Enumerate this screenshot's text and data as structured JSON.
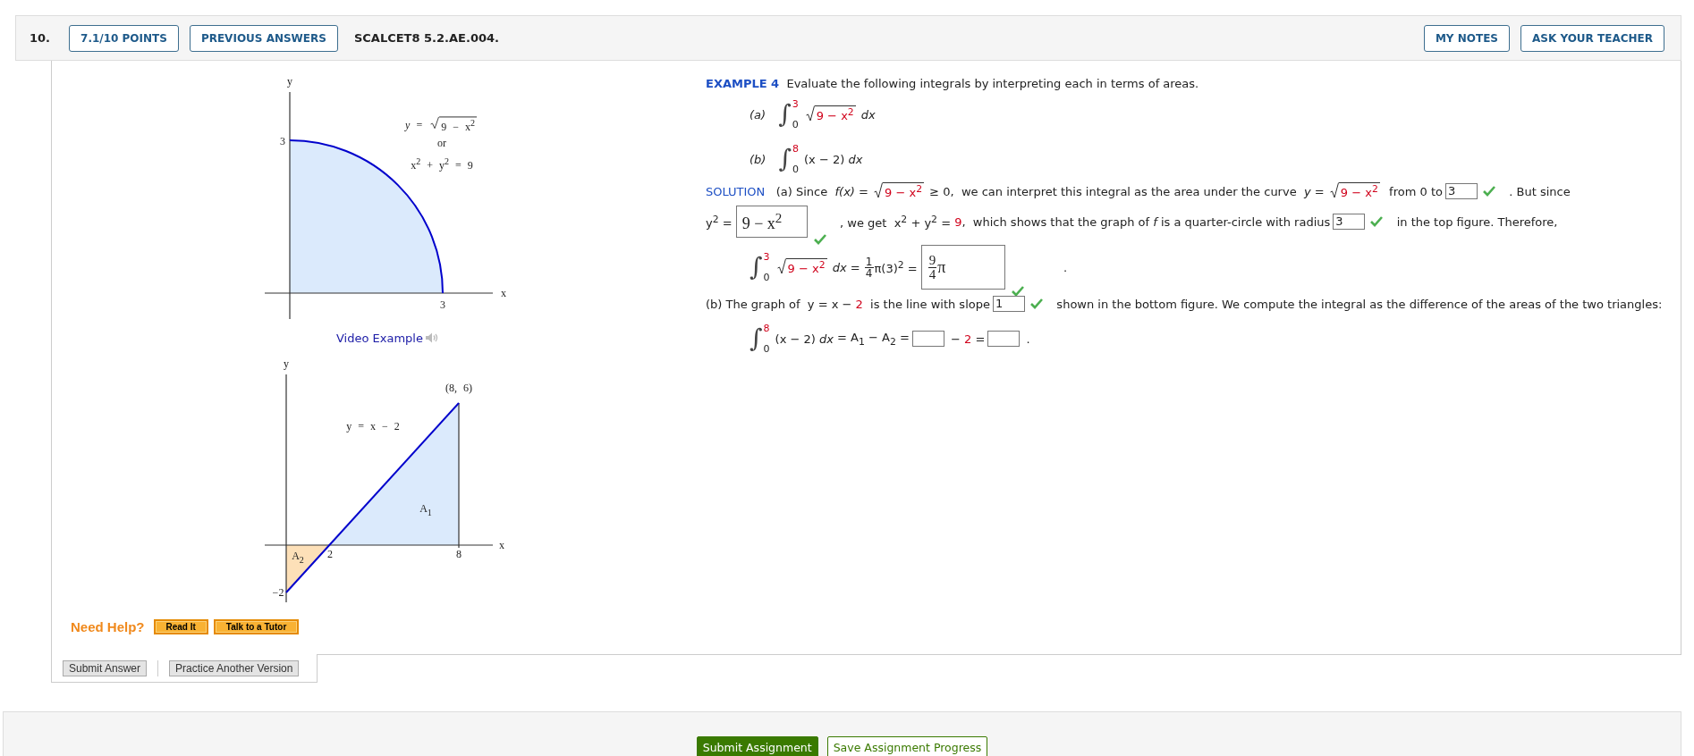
{
  "header": {
    "number": "10.",
    "buttons": [
      {
        "label": "7.1/10 POINTS"
      },
      {
        "label": "PREVIOUS ANSWERS"
      }
    ],
    "code": "SCALCET8 5.2.AE.004.",
    "right_buttons": [
      {
        "label": "MY NOTES"
      },
      {
        "label": "ASK YOUR TEACHER"
      }
    ]
  },
  "figures": [
    {
      "kind": "quarter-circle",
      "labels": [
        {
          "kind": "y-axis",
          "text": "y"
        },
        {
          "kind": "y-tick",
          "text": "3"
        },
        {
          "kind": "equation",
          "tokens": [
            {
              "kind": "em",
              "text": "y"
            },
            {
              "kind": "text",
              "text": " = "
            },
            {
              "kind": "sqrt",
              "body": [
                {
                  "kind": "text",
                  "text": "9 − x$^{2}$"
                }
              ]
            }
          ]
        },
        {
          "kind": "or",
          "text": "or"
        },
        {
          "kind": "circle-equation",
          "text": "x$^{2}$ + y$^{2}$ = 9"
        },
        {
          "kind": "x-axis",
          "text": "x"
        },
        {
          "kind": "x-tick",
          "text": "3"
        }
      ]
    },
    {
      "kind": "triangles",
      "labels": [
        {
          "kind": "y-axis",
          "text": "y"
        },
        {
          "kind": "point",
          "text": "(8, 6)"
        },
        {
          "kind": "line-equation",
          "text": "y = x − 2"
        },
        {
          "kind": "area-upper",
          "text": "A$_{1}$"
        },
        {
          "kind": "area-lower",
          "text": "A$_{2}$"
        },
        {
          "kind": "x-tick-zero",
          "text": "2"
        },
        {
          "kind": "x-tick-end",
          "text": "8"
        },
        {
          "kind": "x-axis",
          "text": "x"
        },
        {
          "kind": "y-tick",
          "text": "−2"
        }
      ]
    }
  ],
  "video_link": {
    "label": "Video Example"
  },
  "help": {
    "label": "Need Help?",
    "buttons": [
      {
        "label": "Read It"
      },
      {
        "label": "Talk to a Tutor"
      }
    ]
  },
  "question_buttons": [
    {
      "label": "Submit Answer"
    },
    {
      "label": "Practice Another Version"
    }
  ],
  "example": {
    "lines": [
      {
        "kind": "heading",
        "tokens": [
          {
            "kind": "label",
            "text": "EXAMPLE 4"
          },
          {
            "kind": "text",
            "text": "  Evaluate the following integrals by interpreting each in terms of areas."
          }
        ]
      },
      {
        "kind": "part",
        "tokens": [
          {
            "kind": "em",
            "text": "(a)"
          },
          {
            "kind": "int",
            "sign": "∫",
            "upper": "3",
            "upper_red": true,
            "lower": "0"
          },
          {
            "kind": "sqrt",
            "body": [
              {
                "kind": "red",
                "text": "9 − x$^{2}$"
              }
            ]
          },
          {
            "kind": "em",
            "text": " dx"
          }
        ]
      },
      {
        "kind": "part",
        "tokens": [
          {
            "kind": "em",
            "text": "(b)"
          },
          {
            "kind": "int",
            "sign": "∫",
            "upper": "8",
            "upper_red": true,
            "lower": "0"
          },
          {
            "kind": "text",
            "text": "(x − 2) "
          },
          {
            "kind": "em",
            "text": "dx"
          }
        ]
      },
      {
        "kind": "plain",
        "tokens": [
          {
            "kind": "label",
            "text": "SOLUTION"
          },
          {
            "kind": "text",
            "text": "   (a) Since  "
          },
          {
            "kind": "em",
            "text": "f(x)"
          },
          {
            "kind": "text",
            "text": " = "
          },
          {
            "kind": "sqrt",
            "body": [
              {
                "kind": "red",
                "text": "9 − x$^{2}$"
              }
            ]
          },
          {
            "kind": "text",
            "text": " ≥ 0,  we can interpret this integral as the area under the curve  "
          },
          {
            "kind": "em",
            "text": "y"
          },
          {
            "kind": "text",
            "text": " = "
          },
          {
            "kind": "sqrt",
            "body": [
              {
                "kind": "red",
                "text": "9 − x$^{2}$"
              }
            ]
          },
          {
            "kind": "text",
            "text": "  from 0 to"
          },
          {
            "kind": "input",
            "value": "3",
            "correct": true
          },
          {
            "kind": "text",
            "text": "   . But since"
          }
        ]
      },
      {
        "kind": "plain",
        "tokens": [
          {
            "kind": "text",
            "text": "y$^{2}$ ="
          },
          {
            "kind": "box",
            "correct": true,
            "body": [
              {
                "kind": "serif",
                "text": "9 − x$^{2}$"
              }
            ]
          },
          {
            "kind": "text",
            "text": "   , we get  x$^{2}$ + y$^{2}$ = "
          },
          {
            "kind": "red",
            "text": "9"
          },
          {
            "kind": "text",
            "text": ",  which shows that the graph of "
          },
          {
            "kind": "em",
            "text": "f"
          },
          {
            "kind": "text",
            "text": " is a quarter-circle with radius"
          },
          {
            "kind": "input",
            "value": "3",
            "correct": true
          },
          {
            "kind": "text",
            "text": "   in the top figure. Therefore,"
          }
        ]
      },
      {
        "kind": "display",
        "tokens": [
          {
            "kind": "int",
            "sign": "∫",
            "upper": "3",
            "upper_red": true,
            "lower": "0"
          },
          {
            "kind": "sqrt",
            "body": [
              {
                "kind": "red",
                "text": "9 − x$^{2}$"
              }
            ]
          },
          {
            "kind": "em",
            "text": " dx"
          },
          {
            "kind": "text",
            "text": " = "
          },
          {
            "kind": "frac",
            "num": "1",
            "den": "4"
          },
          {
            "kind": "text",
            "text": "π(3)$^{2}$ ="
          },
          {
            "kind": "box",
            "correct": true,
            "body": [
              {
                "kind": "frac",
                "num": "9",
                "den": "4"
              },
              {
                "kind": "serif",
                "text": "π"
              }
            ]
          },
          {
            "kind": "text",
            "text": "          ."
          }
        ]
      },
      {
        "kind": "plain",
        "tokens": [
          {
            "kind": "text",
            "text": "(b) The graph of  y = x − "
          },
          {
            "kind": "red",
            "text": "2"
          },
          {
            "kind": "text",
            "text": "  is the line with slope"
          },
          {
            "kind": "input",
            "value": "1",
            "correct": true
          },
          {
            "kind": "text",
            "text": "   shown in the bottom figure. We compute the integral as the difference of the areas of the two triangles:"
          }
        ]
      },
      {
        "kind": "display",
        "tokens": [
          {
            "kind": "int",
            "sign": "∫",
            "upper": "8",
            "upper_red": true,
            "lower": "0"
          },
          {
            "kind": "text",
            "text": "(x − 2) "
          },
          {
            "kind": "em",
            "text": "dx"
          },
          {
            "kind": "text",
            "text": " = A$_{1}$ − A$_{2}$ ="
          },
          {
            "kind": "input",
            "correct": false
          },
          {
            "kind": "text",
            "text": " − "
          },
          {
            "kind": "red",
            "text": "2"
          },
          {
            "kind": "text",
            "text": " ="
          },
          {
            "kind": "input",
            "correct": false
          },
          {
            "kind": "text",
            "text": " ."
          }
        ]
      }
    ]
  },
  "footer_buttons": [
    {
      "label": "Submit Assignment",
      "primary": true
    },
    {
      "label": "Save Assignment Progress",
      "primary": false
    }
  ]
}
